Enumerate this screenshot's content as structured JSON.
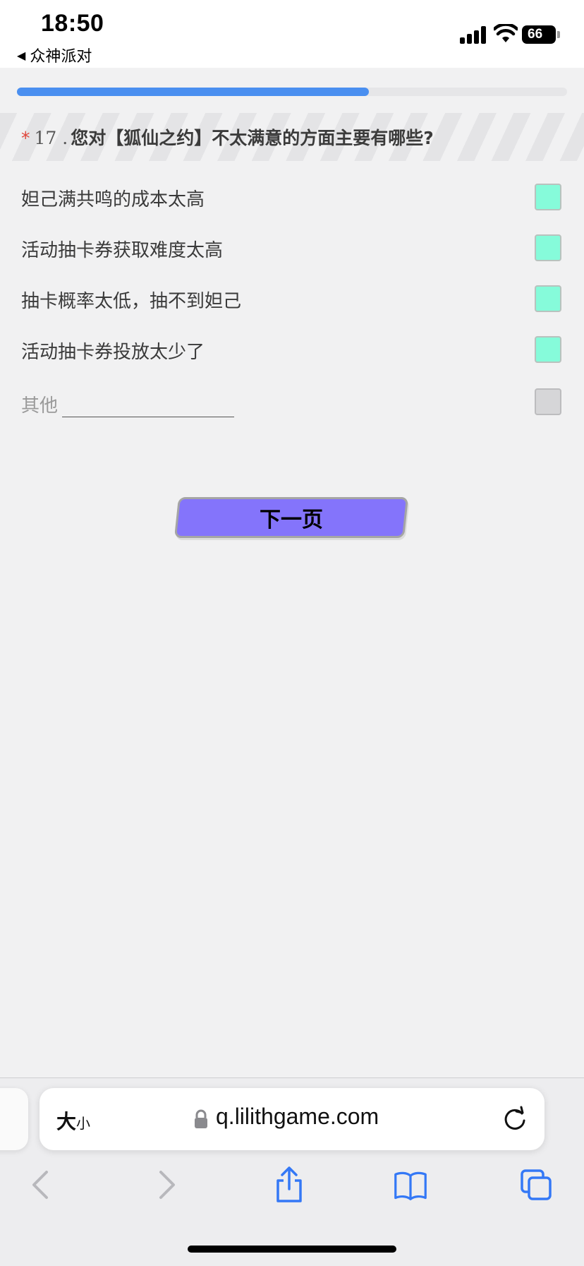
{
  "status_bar": {
    "time": "18:50",
    "back_app": "众神派对",
    "back_arrow": "◀",
    "battery": "66"
  },
  "progress": {
    "fraction": 0.64
  },
  "question": {
    "required_mark": "*",
    "number": "17 .",
    "text": "您对【狐仙之约】不太满意的方面主要有哪些?"
  },
  "options": [
    {
      "label": "妲己满共鸣的成本太高",
      "checked": true
    },
    {
      "label": "活动抽卡券获取难度太高",
      "checked": true
    },
    {
      "label": "抽卡概率太低，抽不到妲己",
      "checked": true
    },
    {
      "label": "活动抽卡券投放太少了",
      "checked": true
    }
  ],
  "other": {
    "label": "其他",
    "value": "",
    "checked": false
  },
  "next_button": {
    "label": "下一页"
  },
  "browser": {
    "size_big": "大",
    "size_small": "小",
    "url": "q.lilithgame.com"
  },
  "colors": {
    "checked_fill": "#86fbda",
    "progress": "#4a8ff0",
    "button": "#8474fb",
    "required": "#e0463b",
    "safari_blue": "#3478f6"
  },
  "icons": {
    "lock": "lock-icon",
    "reload": "reload-icon",
    "back": "chevron-left-icon",
    "forward": "chevron-right-icon",
    "share": "share-icon",
    "bookmarks": "book-icon",
    "tabs": "tabs-icon"
  }
}
